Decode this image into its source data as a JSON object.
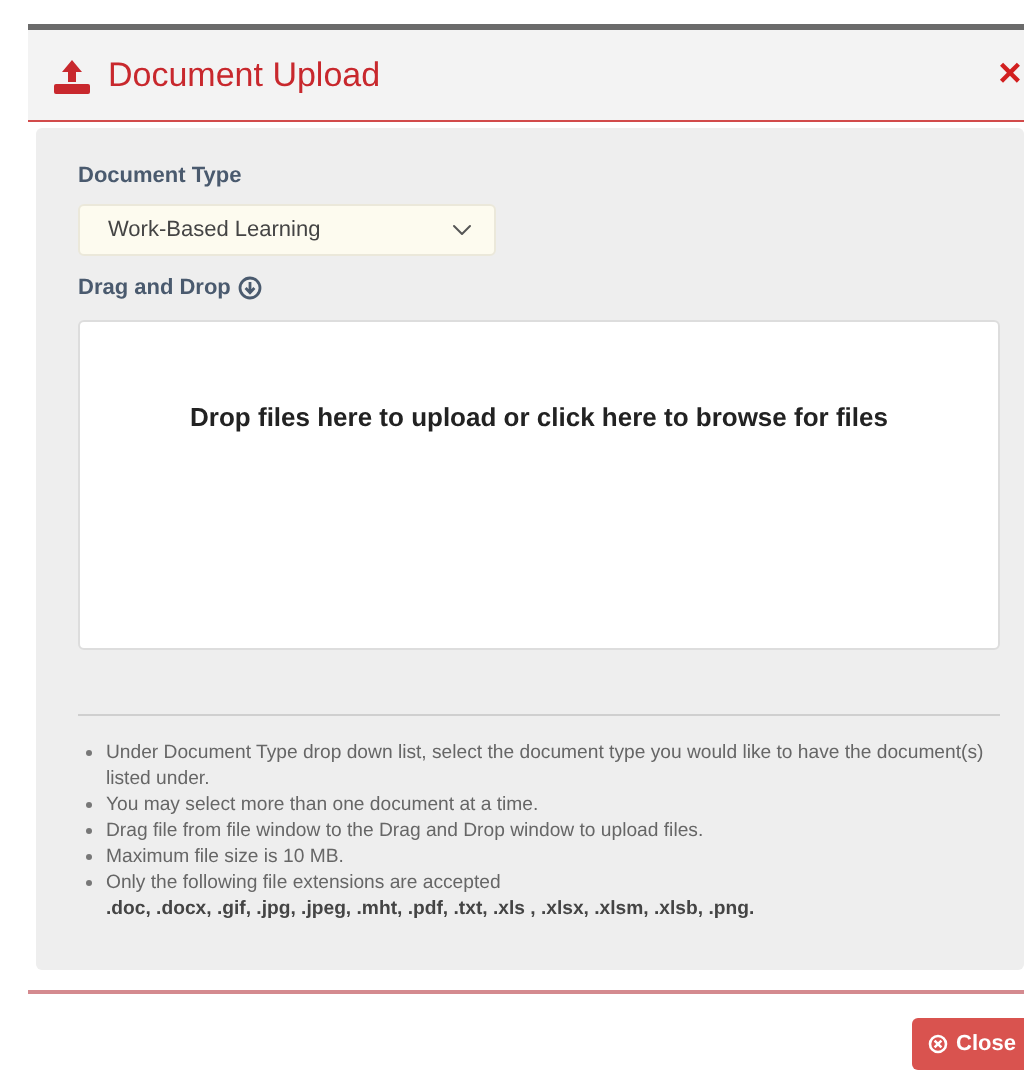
{
  "dialog": {
    "title": "Document Upload",
    "close_glyph": "×"
  },
  "document_type": {
    "label": "Document Type",
    "value": "Work-Based Learning"
  },
  "drop_zone": {
    "label": "Drag and Drop",
    "prompt": "Drop files here to upload or click here to browse for files"
  },
  "instructions": [
    {
      "text": "Under Document Type drop down list, select the document type you would like to have the document(s) listed under."
    },
    {
      "text": "You may select more than one document at a time."
    },
    {
      "text": "Drag file from file window to the Drag and Drop window to upload files."
    },
    {
      "text": "Maximum file size is 10 MB."
    },
    {
      "text": "Only the following file extensions are accepted",
      "note": ".doc, .docx, .gif, .jpg, .jpeg, .mht, .pdf, .txt, .xls , .xlsx, .xlsm, .xlsb, .png."
    }
  ],
  "footer": {
    "button": "Close"
  }
}
